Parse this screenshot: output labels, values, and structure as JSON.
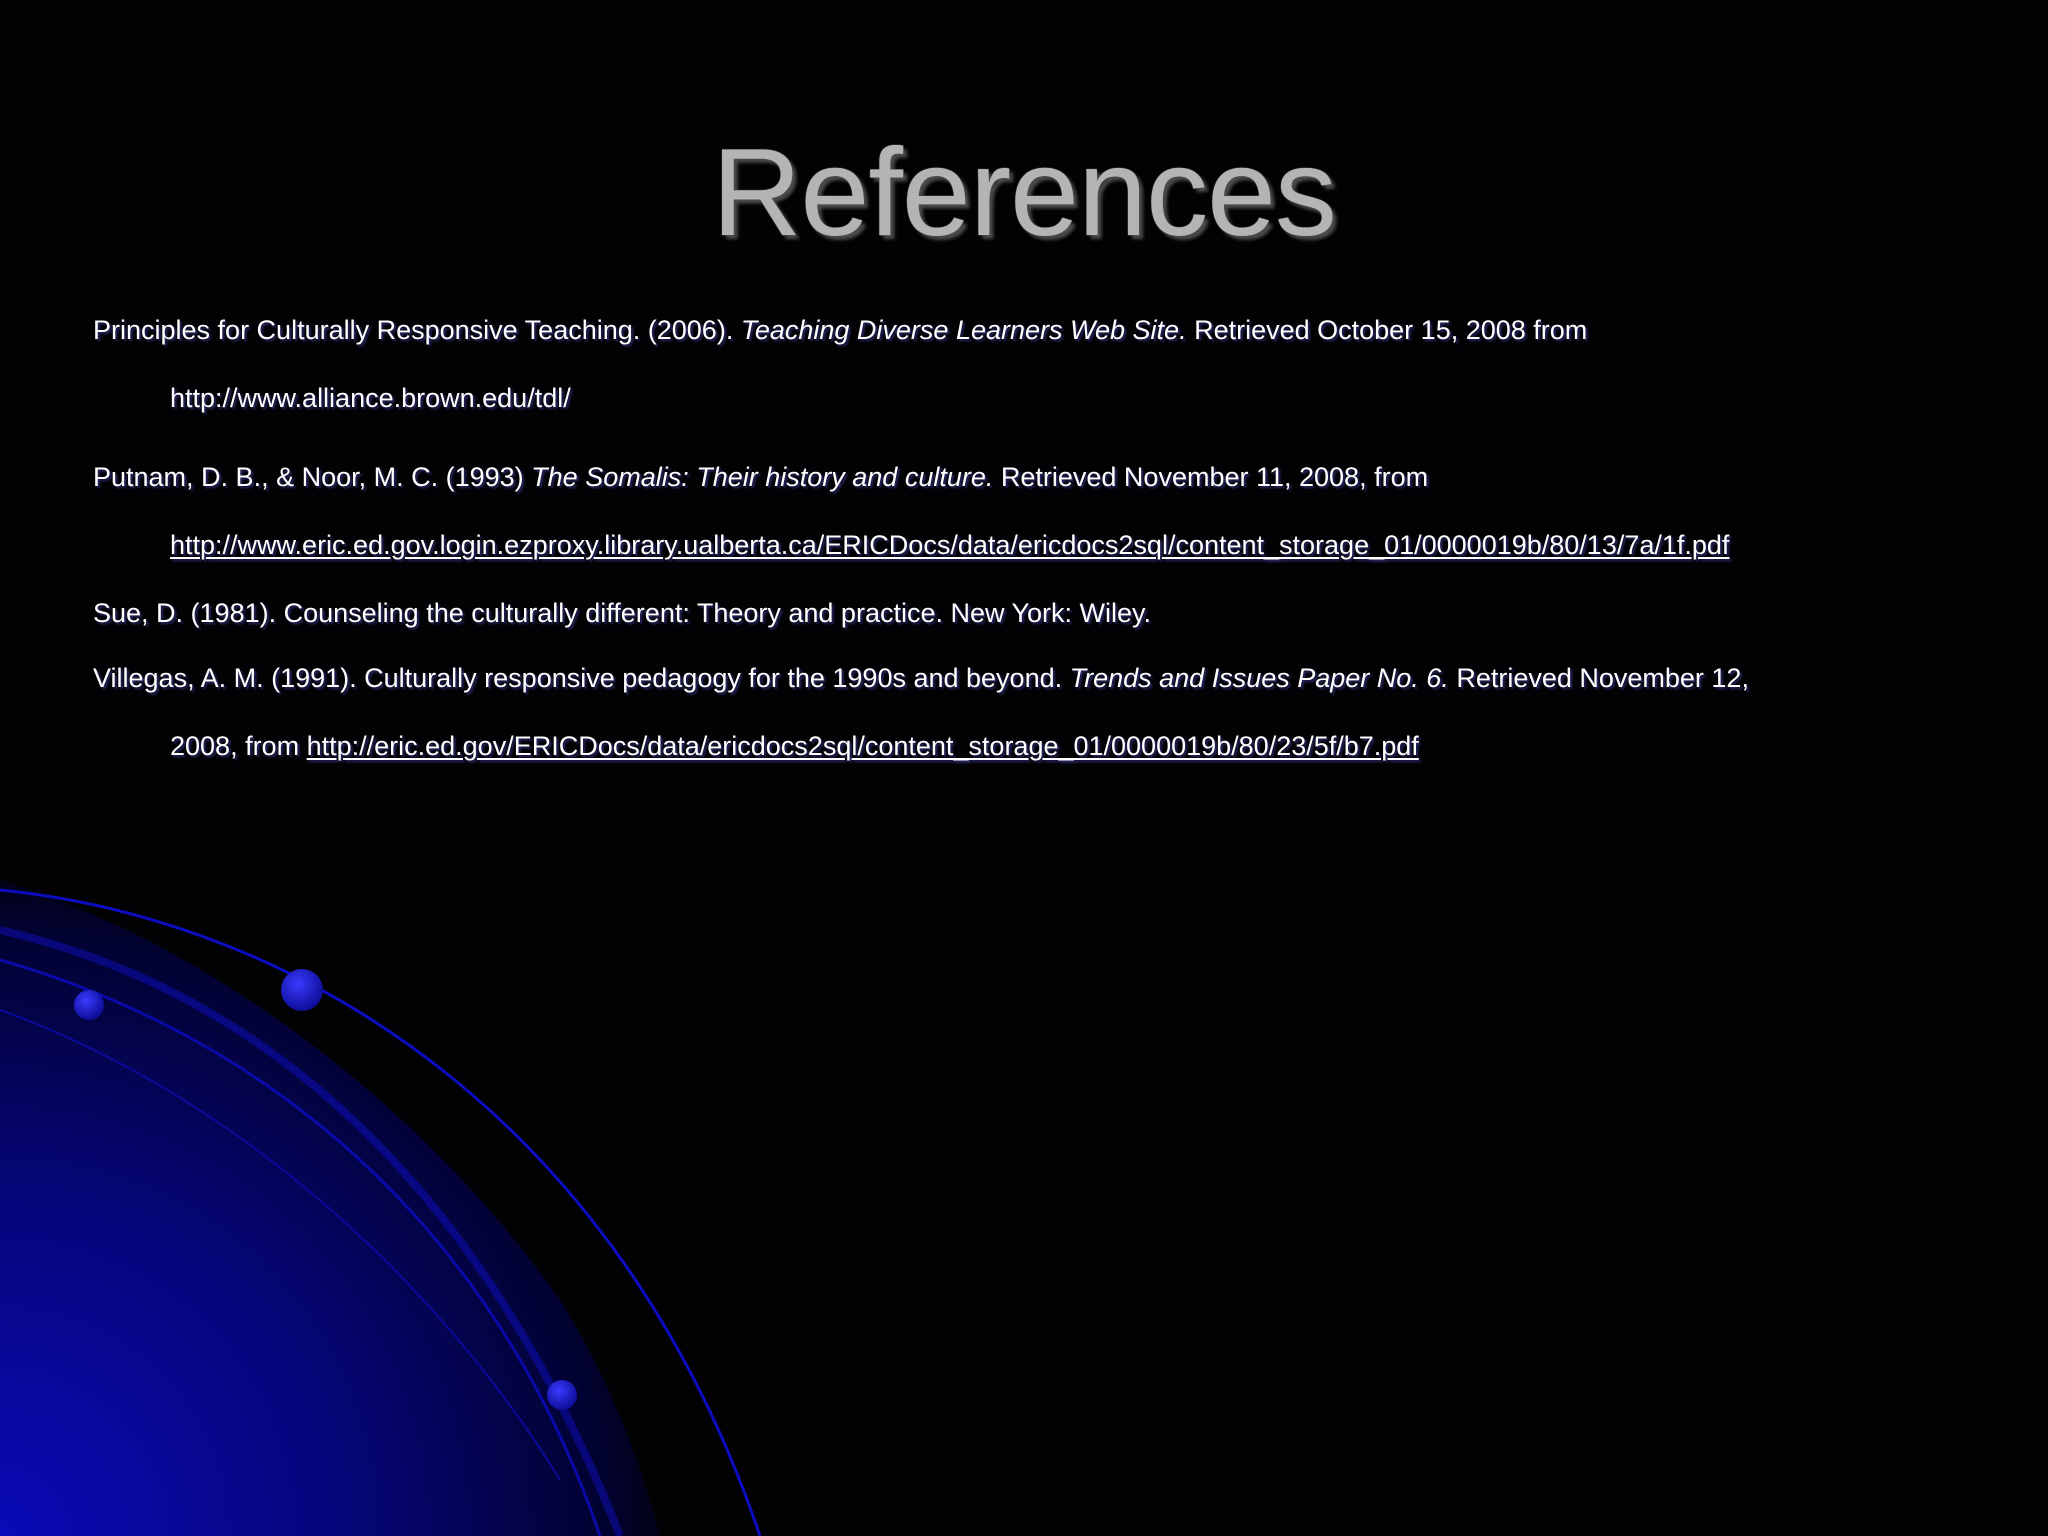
{
  "slide": {
    "title": "References",
    "references": [
      {
        "part1": "Principles for Culturally Responsive Teaching. (2006). ",
        "italic": "Teaching Diverse Learners Web Site.",
        "part2": " Retrieved October 15, 2008 from",
        "line2": "http://www.alliance.brown.edu/tdl/"
      },
      {
        "part1": "Putnam, D. B., & Noor, M. C. (1993) ",
        "italic": "The Somalis: Their history and culture.",
        "part2": " Retrieved November 11, 2008, from",
        "link": "http://www.eric.ed.gov.login.ezproxy.library.ualberta.ca/ERICDocs/data/ericdocs2sql/content_storage_01/0000019b/80/13/7a/1f.pdf"
      },
      {
        "text": "Sue, D. (1981). Counseling the culturally different: Theory and practice. New York: Wiley."
      },
      {
        "part1": "Villegas, A. M. (1991). Culturally responsive pedagogy for the 1990s and beyond. ",
        "italic": "Trends and Issues Paper No. 6.",
        "part2": " Retrieved November 12,",
        "line2_prefix": "2008, from ",
        "link": "http://eric.ed.gov/ERICDocs/data/ericdocs2sql/content_storage_01/0000019b/80/23/5f/b7.pdf"
      }
    ]
  },
  "colors": {
    "background": "#020204",
    "accent_blue": "#0a0ab4",
    "title_gray": "#b4b4b4",
    "text": "#ffffff"
  }
}
